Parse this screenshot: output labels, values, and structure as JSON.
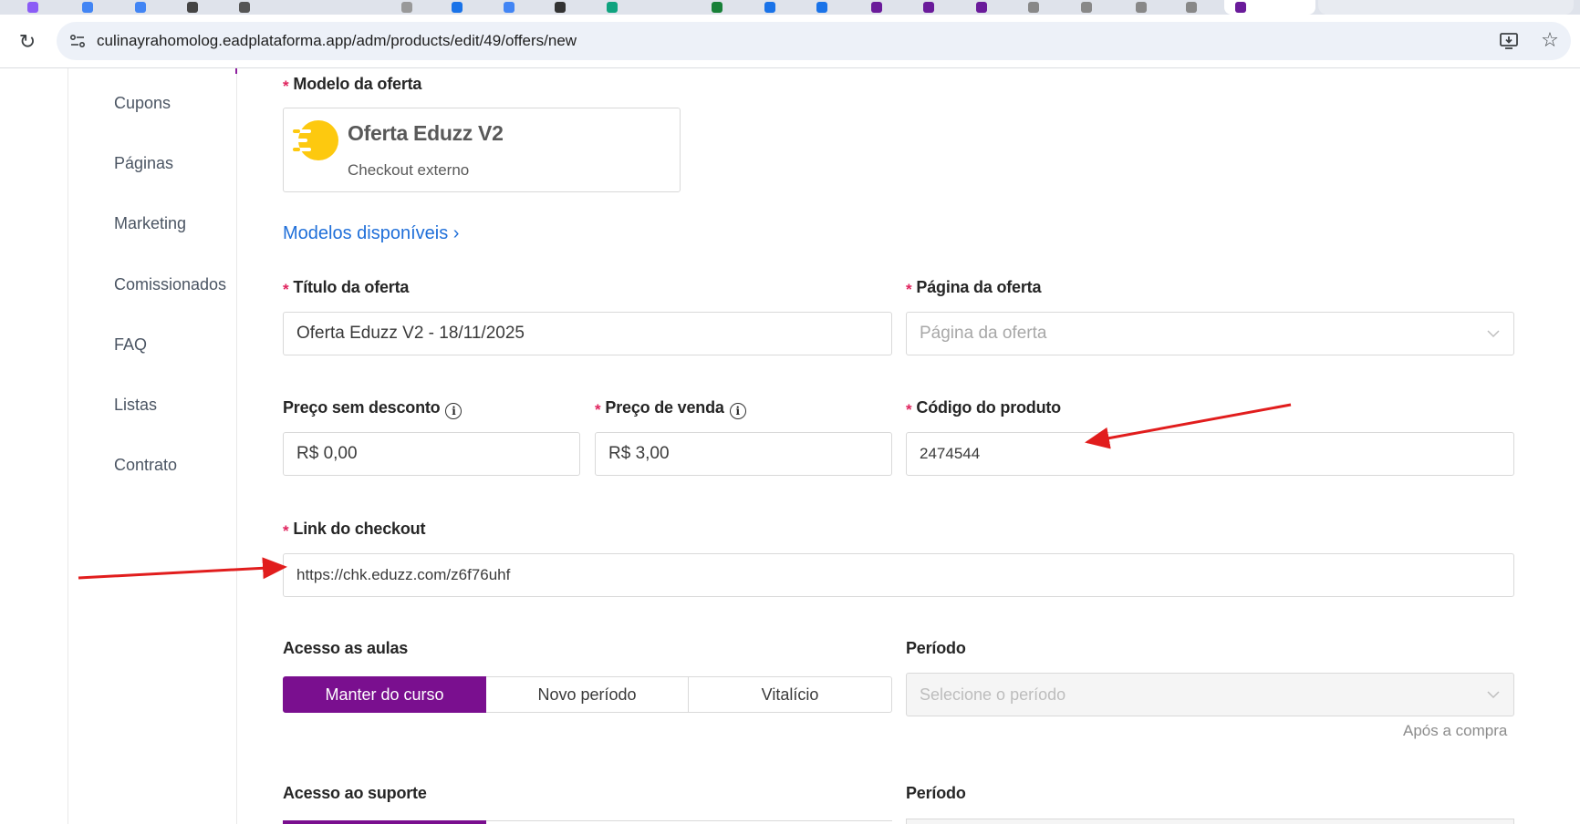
{
  "browser": {
    "url": "culinayrahomolog.eadplataforma.app/adm/products/edit/49/offers/new"
  },
  "sidebar": {
    "items": [
      {
        "label": "Cupons"
      },
      {
        "label": "Páginas"
      },
      {
        "label": "Marketing"
      },
      {
        "label": "Comissionados"
      },
      {
        "label": "FAQ"
      },
      {
        "label": "Listas"
      },
      {
        "label": "Contrato"
      }
    ]
  },
  "form": {
    "model_label": "Modelo da oferta",
    "model_title": "Oferta Eduzz V2",
    "model_subtitle": "Checkout externo",
    "models_link": "Modelos disponíveis",
    "models_link_chevron": "›",
    "title_label": "Título da oferta",
    "title_value": "Oferta Eduzz V2 - 18/11/2025",
    "page_label": "Página da oferta",
    "page_placeholder": "Página da oferta",
    "price_label": "Preço sem desconto",
    "price_value": "R$ 0,00",
    "sale_price_label": "Preço de venda",
    "sale_price_value": "R$ 3,00",
    "product_code_label": "Código do produto",
    "product_code_value": "2474544",
    "checkout_label": "Link do checkout",
    "checkout_value": "https://chk.eduzz.com/z6f76uhf",
    "access_label": "Acesso as aulas",
    "access_options": [
      "Manter do curso",
      "Novo período",
      "Vitalício"
    ],
    "access_selected": 0,
    "period_label": "Período",
    "period_placeholder": "Selecione o período",
    "period_hint": "Após a compra",
    "support_label": "Acesso ao suporte",
    "support_period_label": "Período",
    "required_mark": "*",
    "info_glyph": "i"
  },
  "colors": {
    "accent": "#7a0f8f",
    "link": "#1f6fd9",
    "required": "#e0245e",
    "annotation_arrow": "#e11d1d"
  }
}
